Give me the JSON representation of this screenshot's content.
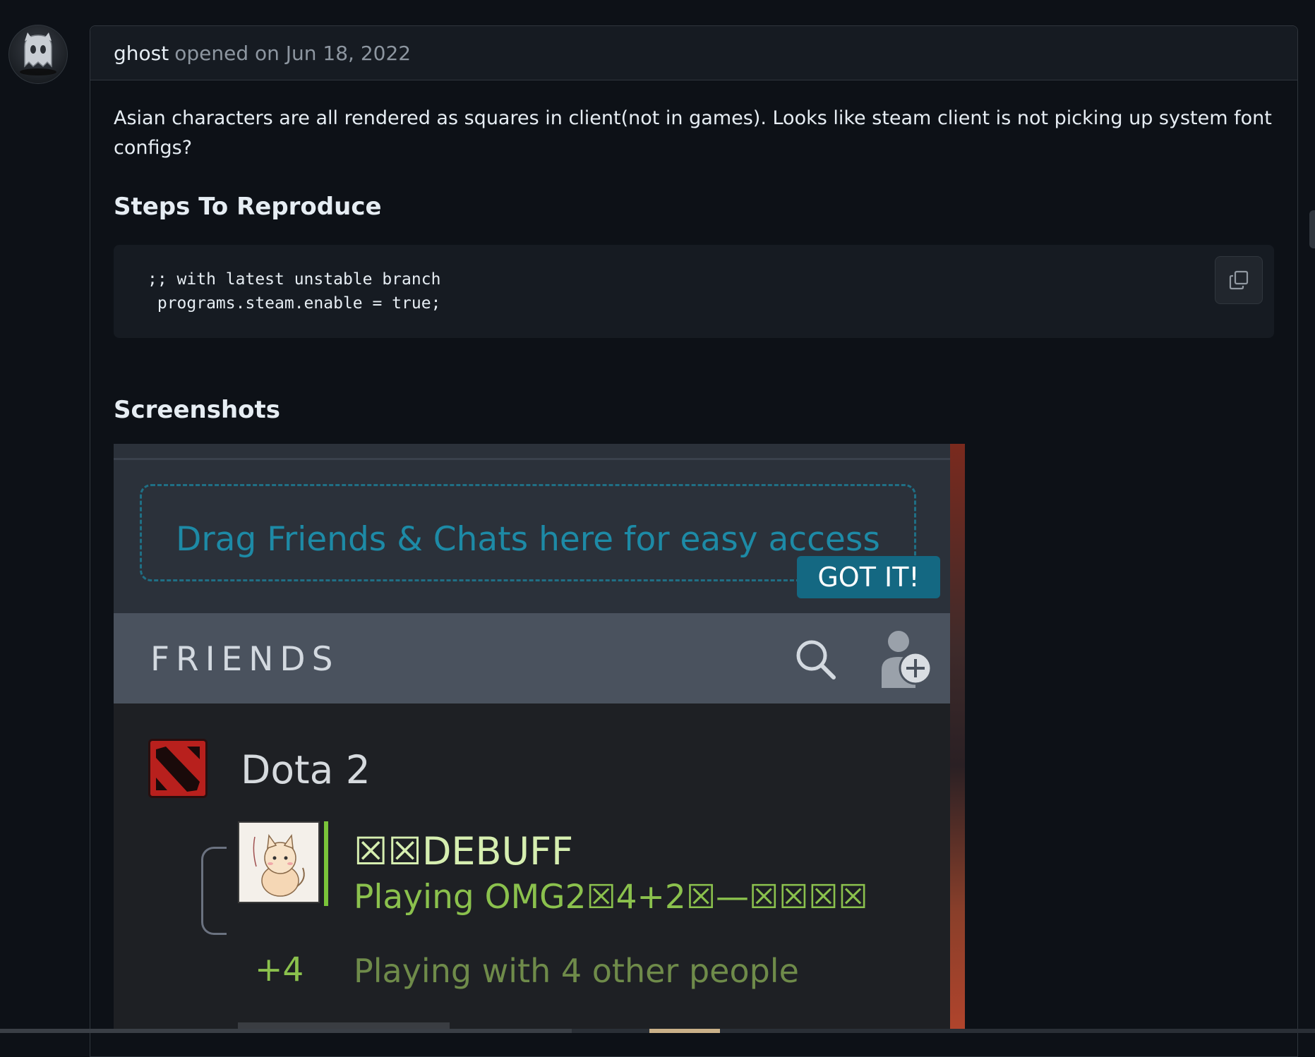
{
  "comment": {
    "author": "ghost",
    "meta": "opened on Jun 18, 2022",
    "body_text": "Asian characters are all rendered as squares in client(not in games). Looks like steam client is not picking up system font configs?",
    "steps_heading": "Steps To Reproduce",
    "code_lines": [
      ";; with latest unstable branch",
      " programs.steam.enable = true;"
    ],
    "copy_icon": "copy-icon",
    "screenshots_heading": "Screenshots"
  },
  "embedded_screenshot": {
    "drop_zone_text": "Drag Friends & Chats here for easy access",
    "got_it_label": "GOT IT!",
    "friends_label": "FRIENDS",
    "search_icon": "search-icon",
    "add_friend_icon": "add-friend-icon",
    "game_name": "Dota 2",
    "friend_name": "☒☒DEBUFF",
    "friend_status": "Playing OMG2☒4+2☒—☒☒☒☒",
    "group_count": "+4",
    "group_status": "Playing with 4 other people"
  },
  "colors": {
    "page_bg": "#0d1117",
    "steam_accent": "#1d8aa6",
    "steam_online_green": "#8bc14d",
    "dota_red": "#b8201d"
  }
}
